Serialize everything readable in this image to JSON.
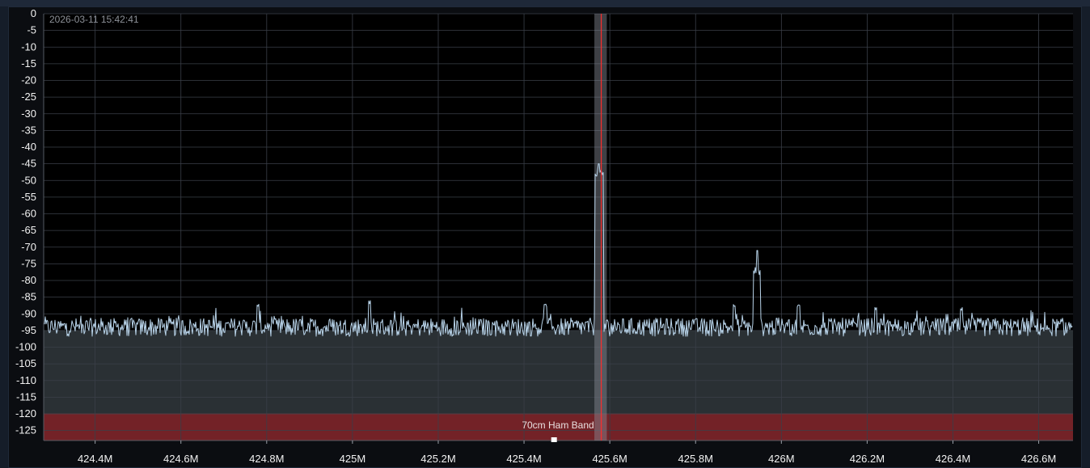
{
  "timestamp": "2026-03-11 15:42:41",
  "band_label": "70cm Ham Band",
  "colors": {
    "background": "#000000",
    "grid": "#3a3f48",
    "trace": "#b9d4ea",
    "fill": "#2a3034",
    "band": "#7a2226",
    "marker": "#ff2b2b",
    "channel": "#8a8f99"
  },
  "chart_data": {
    "type": "line",
    "title": "",
    "xlabel": "",
    "ylabel": "",
    "xlim": [
      424.28,
      426.68
    ],
    "ylim": [
      -128,
      0
    ],
    "grid": true,
    "y_ticks": [
      0,
      -5,
      -10,
      -15,
      -20,
      -25,
      -30,
      -35,
      -40,
      -45,
      -50,
      -55,
      -60,
      -65,
      -70,
      -75,
      -80,
      -85,
      -90,
      -95,
      -100,
      -105,
      -110,
      -115,
      -120,
      -125
    ],
    "x_ticks": [
      {
        "value": 424.4,
        "label": "424.4M"
      },
      {
        "value": 424.6,
        "label": "424.6M"
      },
      {
        "value": 424.8,
        "label": "424.8M"
      },
      {
        "value": 425.0,
        "label": "425M"
      },
      {
        "value": 425.2,
        "label": "425.2M"
      },
      {
        "value": 425.4,
        "label": "425.4M"
      },
      {
        "value": 425.6,
        "label": "425.6M"
      },
      {
        "value": 425.8,
        "label": "425.8M"
      },
      {
        "value": 426.0,
        "label": "426M"
      },
      {
        "value": 426.2,
        "label": "426.2M"
      },
      {
        "value": 426.4,
        "label": "426.4M"
      },
      {
        "value": 426.6,
        "label": "426.6M"
      }
    ],
    "noise_floor": -94,
    "fill_level": -95,
    "band_region": {
      "y_from": -128,
      "y_to": -120
    },
    "marker_freq": 425.58,
    "channel_band": [
      425.564,
      425.593
    ],
    "band_marker_freq": 425.47,
    "peaks": [
      {
        "freq_from": 425.565,
        "freq_to": 425.585,
        "level": -48,
        "max": -45
      },
      {
        "freq_from": 425.935,
        "freq_to": 425.952,
        "level": -77,
        "max": -71
      }
    ],
    "spurs": [
      {
        "freq": 424.78,
        "level": -88
      },
      {
        "freq": 425.04,
        "level": -87
      },
      {
        "freq": 425.45,
        "level": -88
      },
      {
        "freq": 425.89,
        "level": -88
      },
      {
        "freq": 426.04,
        "level": -88
      },
      {
        "freq": 426.22,
        "level": -89
      },
      {
        "freq": 426.42,
        "level": -89
      }
    ]
  }
}
